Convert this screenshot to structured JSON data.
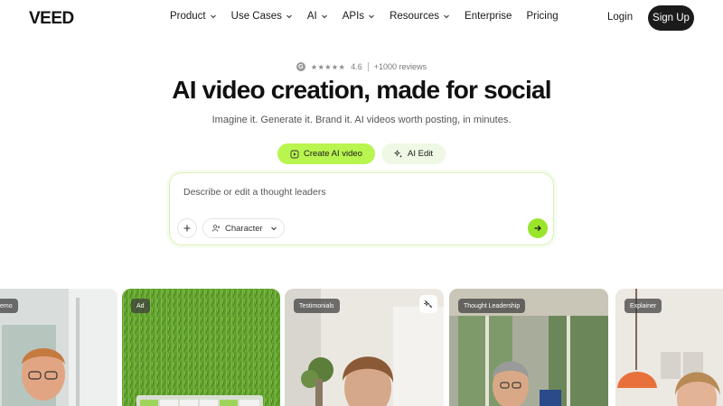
{
  "brand": {
    "logo_text": "VEED"
  },
  "nav": {
    "items": [
      {
        "label": "Product",
        "dropdown": true
      },
      {
        "label": "Use Cases",
        "dropdown": true
      },
      {
        "label": "AI",
        "dropdown": true
      },
      {
        "label": "APIs",
        "dropdown": true
      },
      {
        "label": "Resources",
        "dropdown": true
      },
      {
        "label": "Enterprise",
        "dropdown": false
      },
      {
        "label": "Pricing",
        "dropdown": false
      }
    ],
    "login_label": "Login",
    "signup_label": "Sign Up"
  },
  "rating": {
    "score": "4.6",
    "reviews": "+1000 reviews",
    "stars": "★★★★★"
  },
  "hero": {
    "title": "AI video creation, made for social",
    "subtitle": "Imagine it. Generate it. Brand it. AI videos worth posting, in minutes."
  },
  "modes": [
    {
      "label": "Create AI video",
      "active": true,
      "icon": "video-icon"
    },
    {
      "label": "AI Edit",
      "active": false,
      "icon": "sparkle-icon"
    }
  ],
  "prompt": {
    "text": "Describe or edit a thought leaders",
    "character_label": "Character"
  },
  "cards": [
    {
      "tag": "emo"
    },
    {
      "tag": "Ad"
    },
    {
      "tag": "Testimonials"
    },
    {
      "tag": "Thought Leadership"
    },
    {
      "tag": "Explainer"
    }
  ],
  "colors": {
    "accent": "#b9f54f",
    "accent_soft": "#eef8e4",
    "send": "#9ae52b",
    "dark": "#1b1b1b"
  }
}
